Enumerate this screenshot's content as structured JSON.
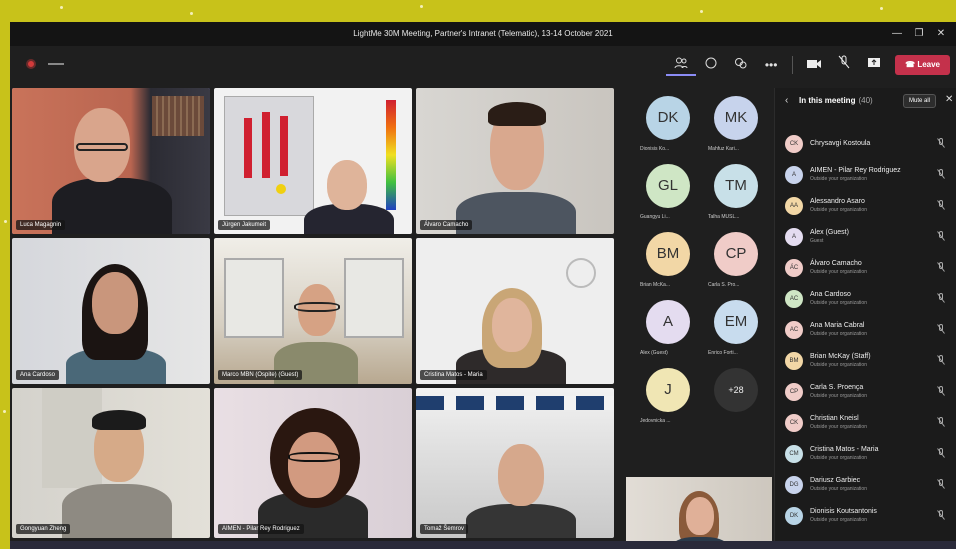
{
  "window": {
    "title": "LightMe 30M Meeting, Partner's Intranet (Telematic), 13-14 October 2021",
    "controls": [
      "—",
      "❐",
      "✕"
    ]
  },
  "toolbar": {
    "left_icons": [
      "record-icon",
      "handle-icon"
    ],
    "right_icons": [
      "people-icon",
      "chat-icon",
      "rooms-icon",
      "more-icon",
      "camera-icon",
      "mic-off-icon",
      "share-icon"
    ],
    "leave_label": "Leave"
  },
  "tiles": [
    {
      "name": "Luca Magagnin"
    },
    {
      "name": "Jürgen Jakumeit"
    },
    {
      "name": "Álvaro Camacho"
    },
    {
      "name": "Ana Cardoso"
    },
    {
      "name": "Marco MBN (Ospite) (Guest)"
    },
    {
      "name": "Cristina Matos - Maria"
    },
    {
      "name": "Gongyuan Zheng"
    },
    {
      "name": "AIMEN - Pilar Rey Rodriguez"
    },
    {
      "name": "Tomaž Šemrov"
    }
  ],
  "roster": [
    {
      "initials": "DK",
      "name": "Dionisis Ko...",
      "color": "#b8d4e6"
    },
    {
      "initials": "MK",
      "name": "Mahfuz Kari...",
      "color": "#c7d3ec"
    },
    {
      "initials": "GL",
      "name": "Guangyu Li...",
      "color": "#cfe6c5"
    },
    {
      "initials": "TM",
      "name": "Talha MUSL...",
      "color": "#c8e0e8"
    },
    {
      "initials": "BM",
      "name": "Brian McKa...",
      "color": "#f2d7a6"
    },
    {
      "initials": "CP",
      "name": "Carla S. Pro...",
      "color": "#f0ccc8"
    },
    {
      "initials": "A",
      "name": "Alex (Guest)",
      "color": "#e4dcf0"
    },
    {
      "initials": "EM",
      "name": "Enrico Forti...",
      "color": "#c8dcee"
    },
    {
      "initials": "J",
      "name": "Jedovnicka ...",
      "color": "#f0e6b4"
    }
  ],
  "more_count": "+28",
  "panel": {
    "title": "In this meeting",
    "count": "(40)",
    "mute_all": "Mute all",
    "participants": [
      {
        "initials": "CK",
        "name": "Chrysavgi Kostoula",
        "sub": "",
        "color": "#f0ccc8"
      },
      {
        "initials": "A",
        "name": "AIMEN - Pilar Rey Rodriguez",
        "sub": "Outside your organization",
        "color": "#c8d3ec"
      },
      {
        "initials": "AA",
        "name": "Alessandro Asaro",
        "sub": "Outside your organization",
        "color": "#f2d7a6"
      },
      {
        "initials": "A",
        "name": "Alex (Guest)",
        "sub": "Guest",
        "color": "#e4dcf0"
      },
      {
        "initials": "ÁC",
        "name": "Álvaro Camacho",
        "sub": "Outside your organization",
        "color": "#f0ccc8"
      },
      {
        "initials": "AC",
        "name": "Ana Cardoso",
        "sub": "Outside your organization",
        "color": "#cfe6c5"
      },
      {
        "initials": "AC",
        "name": "Ana Maria Cabral",
        "sub": "Outside your organization",
        "color": "#f0ccc8"
      },
      {
        "initials": "BM",
        "name": "Brian McKay (Staff)",
        "sub": "Outside your organization",
        "color": "#f2d7a6"
      },
      {
        "initials": "CP",
        "name": "Carla S. Proença",
        "sub": "Outside your organization",
        "color": "#f0ccc8"
      },
      {
        "initials": "CK",
        "name": "Christian Kneisl",
        "sub": "Outside your organization",
        "color": "#f0ccc8"
      },
      {
        "initials": "CM",
        "name": "Cristina Matos - Maria",
        "sub": "Outside your organization",
        "color": "#c8e0e8"
      },
      {
        "initials": "DG",
        "name": "Dariusz Garbiec",
        "sub": "Outside your organization",
        "color": "#c8d3ec"
      },
      {
        "initials": "DK",
        "name": "Dionisis Koutsantonis",
        "sub": "Outside your organization",
        "color": "#b8d4e6"
      }
    ]
  }
}
